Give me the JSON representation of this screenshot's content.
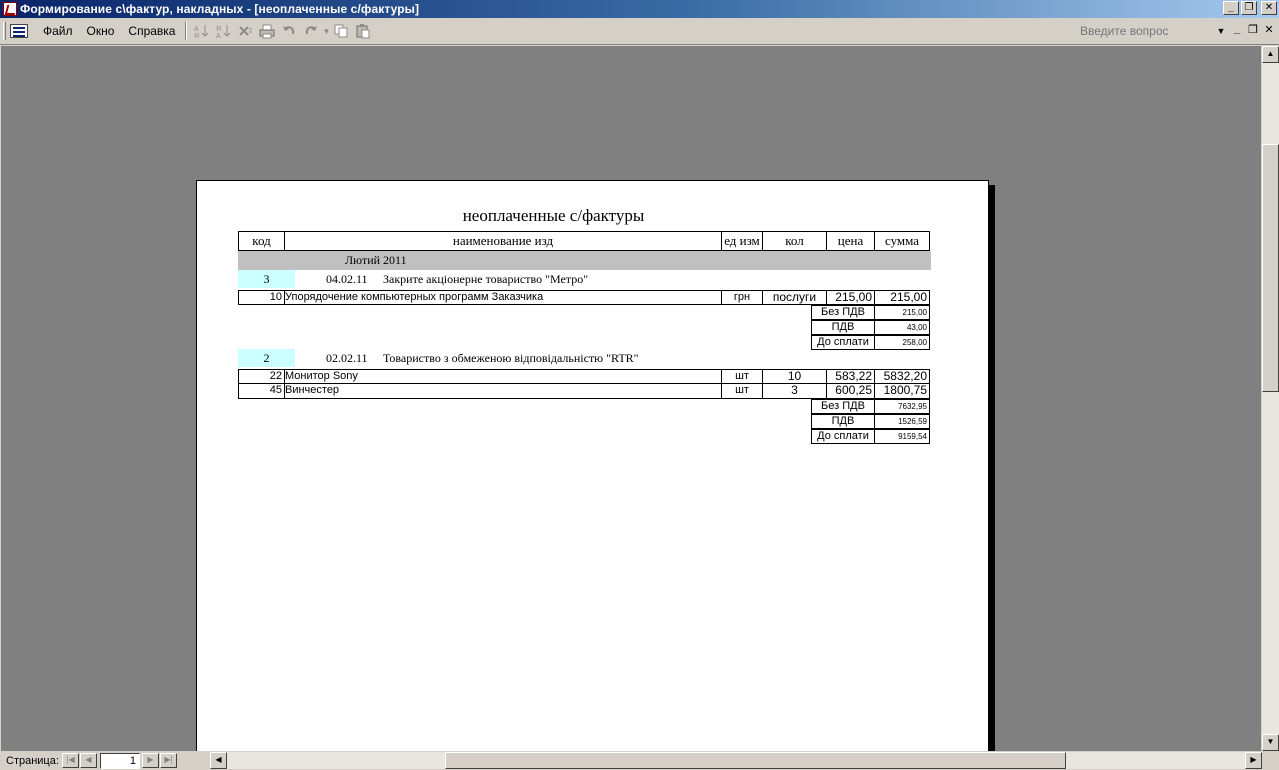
{
  "window": {
    "title": "Формирование с\\фактур, накладных - [неоплаченные с/фактуры]",
    "minimize": "_",
    "restore": "❐",
    "close": "✕"
  },
  "menu": {
    "items": [
      {
        "label": "Файл",
        "icon": ""
      },
      {
        "label": "Окно",
        "icon": ""
      },
      {
        "label": "Справка",
        "icon": ""
      }
    ],
    "toolbar_icons": [
      "sort-ascending-icon",
      "sort-descending-icon",
      "delete-icon",
      "print-icon",
      "undo-icon",
      "redo-icon",
      "copy-icon",
      "paste-icon"
    ],
    "question_placeholder": "Введите вопрос"
  },
  "report": {
    "title": "неоплаченные с/фактуры",
    "columns": [
      "код",
      "наименование изд",
      "ед изм",
      "кол",
      "цена",
      "сумма"
    ],
    "group_label": "Лютий 2011",
    "invoices": [
      {
        "number": "3",
        "date": "04.02.11",
        "client": "Закрите акціонерне товариство \"Метро\"",
        "lines": [
          {
            "code": "10",
            "name": "Упорядочение компьютерных программ Заказчика",
            "unit": "грн",
            "qty": "послуги",
            "price": "215,00",
            "sum": "215,00"
          }
        ],
        "totals": [
          {
            "label": "Без ПДВ",
            "value": "215,00"
          },
          {
            "label": "ПДВ",
            "value": "43,00"
          },
          {
            "label": "До сплати",
            "value": "258,00"
          }
        ]
      },
      {
        "number": "2",
        "date": "02.02.11",
        "client": "Товариство з обмеженою відповідальністю \"RTR\"",
        "lines": [
          {
            "code": "22",
            "name": "Монитор Sony",
            "unit": "шт",
            "qty": "10",
            "price": "583,22",
            "sum": "5832,20"
          },
          {
            "code": "45",
            "name": "Винчестер",
            "unit": "шт",
            "qty": "3",
            "price": "600,25",
            "sum": "1800,75"
          }
        ],
        "totals": [
          {
            "label": "Без ПДВ",
            "value": "7632,95"
          },
          {
            "label": "ПДВ",
            "value": "1526,59"
          },
          {
            "label": "До сплати",
            "value": "9159,54"
          }
        ]
      }
    ]
  },
  "statusbar": {
    "page_label": "Страница:",
    "page_value": "1"
  }
}
